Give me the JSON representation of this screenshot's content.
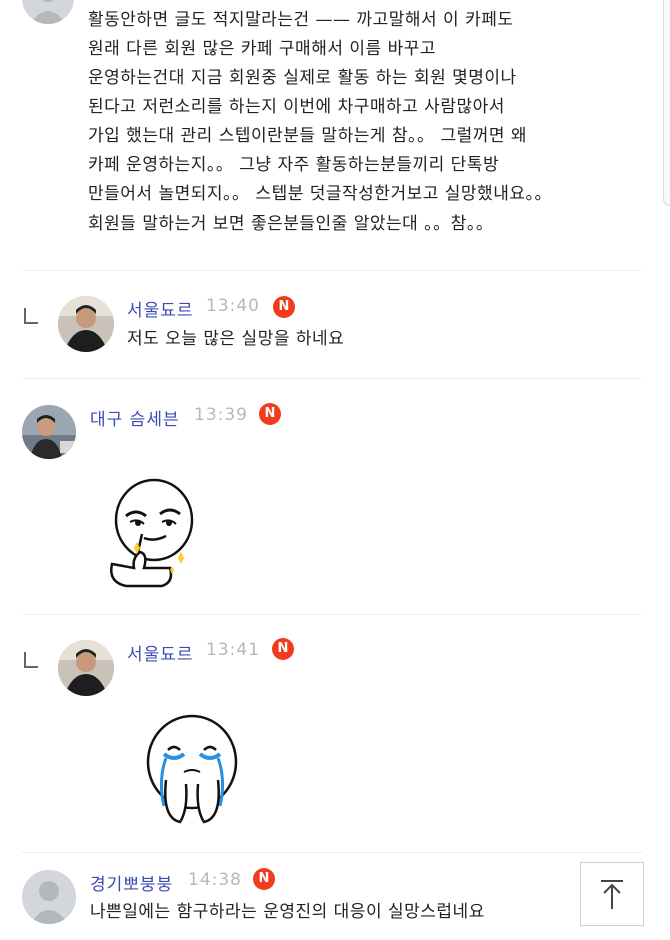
{
  "first_comment": {
    "lines": [
      "활동안하면 글도 적지말라는건 —— 까고말해서 이 카페도",
      "원래 다른 회원 많은 카페 구매해서 이름 바꾸고",
      "운영하는건대 지금 회원중 실제로 활동 하는 회원 몇명이나",
      "된다고 저런소리를 하는지 이번에 차구매하고 사람많아서",
      "가입 했는대 관리 스텝이란분들 말하는게 참。。 그럴꺼면 왜",
      "카페 운영하는지。。 그냥 자주 활동하는분들끼리 단톡방",
      "만들어서 놀면되지。。 스텝분 덧글작성한거보고 실망했내요。。",
      "회원들 말하는거 보면 좋은분들인줄 알았는대 。。참。。"
    ]
  },
  "comments": [
    {
      "nick": "서울됴르",
      "time": "13:40",
      "badge": "N",
      "text": "저도 오늘 많은 실망을 하네요",
      "sticker": ""
    },
    {
      "nick": "대구 슴세븐",
      "time": "13:39",
      "badge": "N",
      "text": "",
      "sticker": "pointing-sticker"
    },
    {
      "nick": "서울됴르",
      "time": "13:41",
      "badge": "N",
      "text": "",
      "sticker": "crying-sticker"
    },
    {
      "nick": "경기뽀붕붕",
      "time": "14:38",
      "badge": "N",
      "text": "나쁜일에는 함구하라는 운영진의 대응이 실망스럽네요",
      "sticker": ""
    }
  ],
  "scroll_top_button": {
    "icon": "arrow-up-to-top-icon"
  },
  "colors": {
    "nickname": "#3b4bb5",
    "badge": "#f03c1c",
    "time": "#b8b8b8"
  }
}
